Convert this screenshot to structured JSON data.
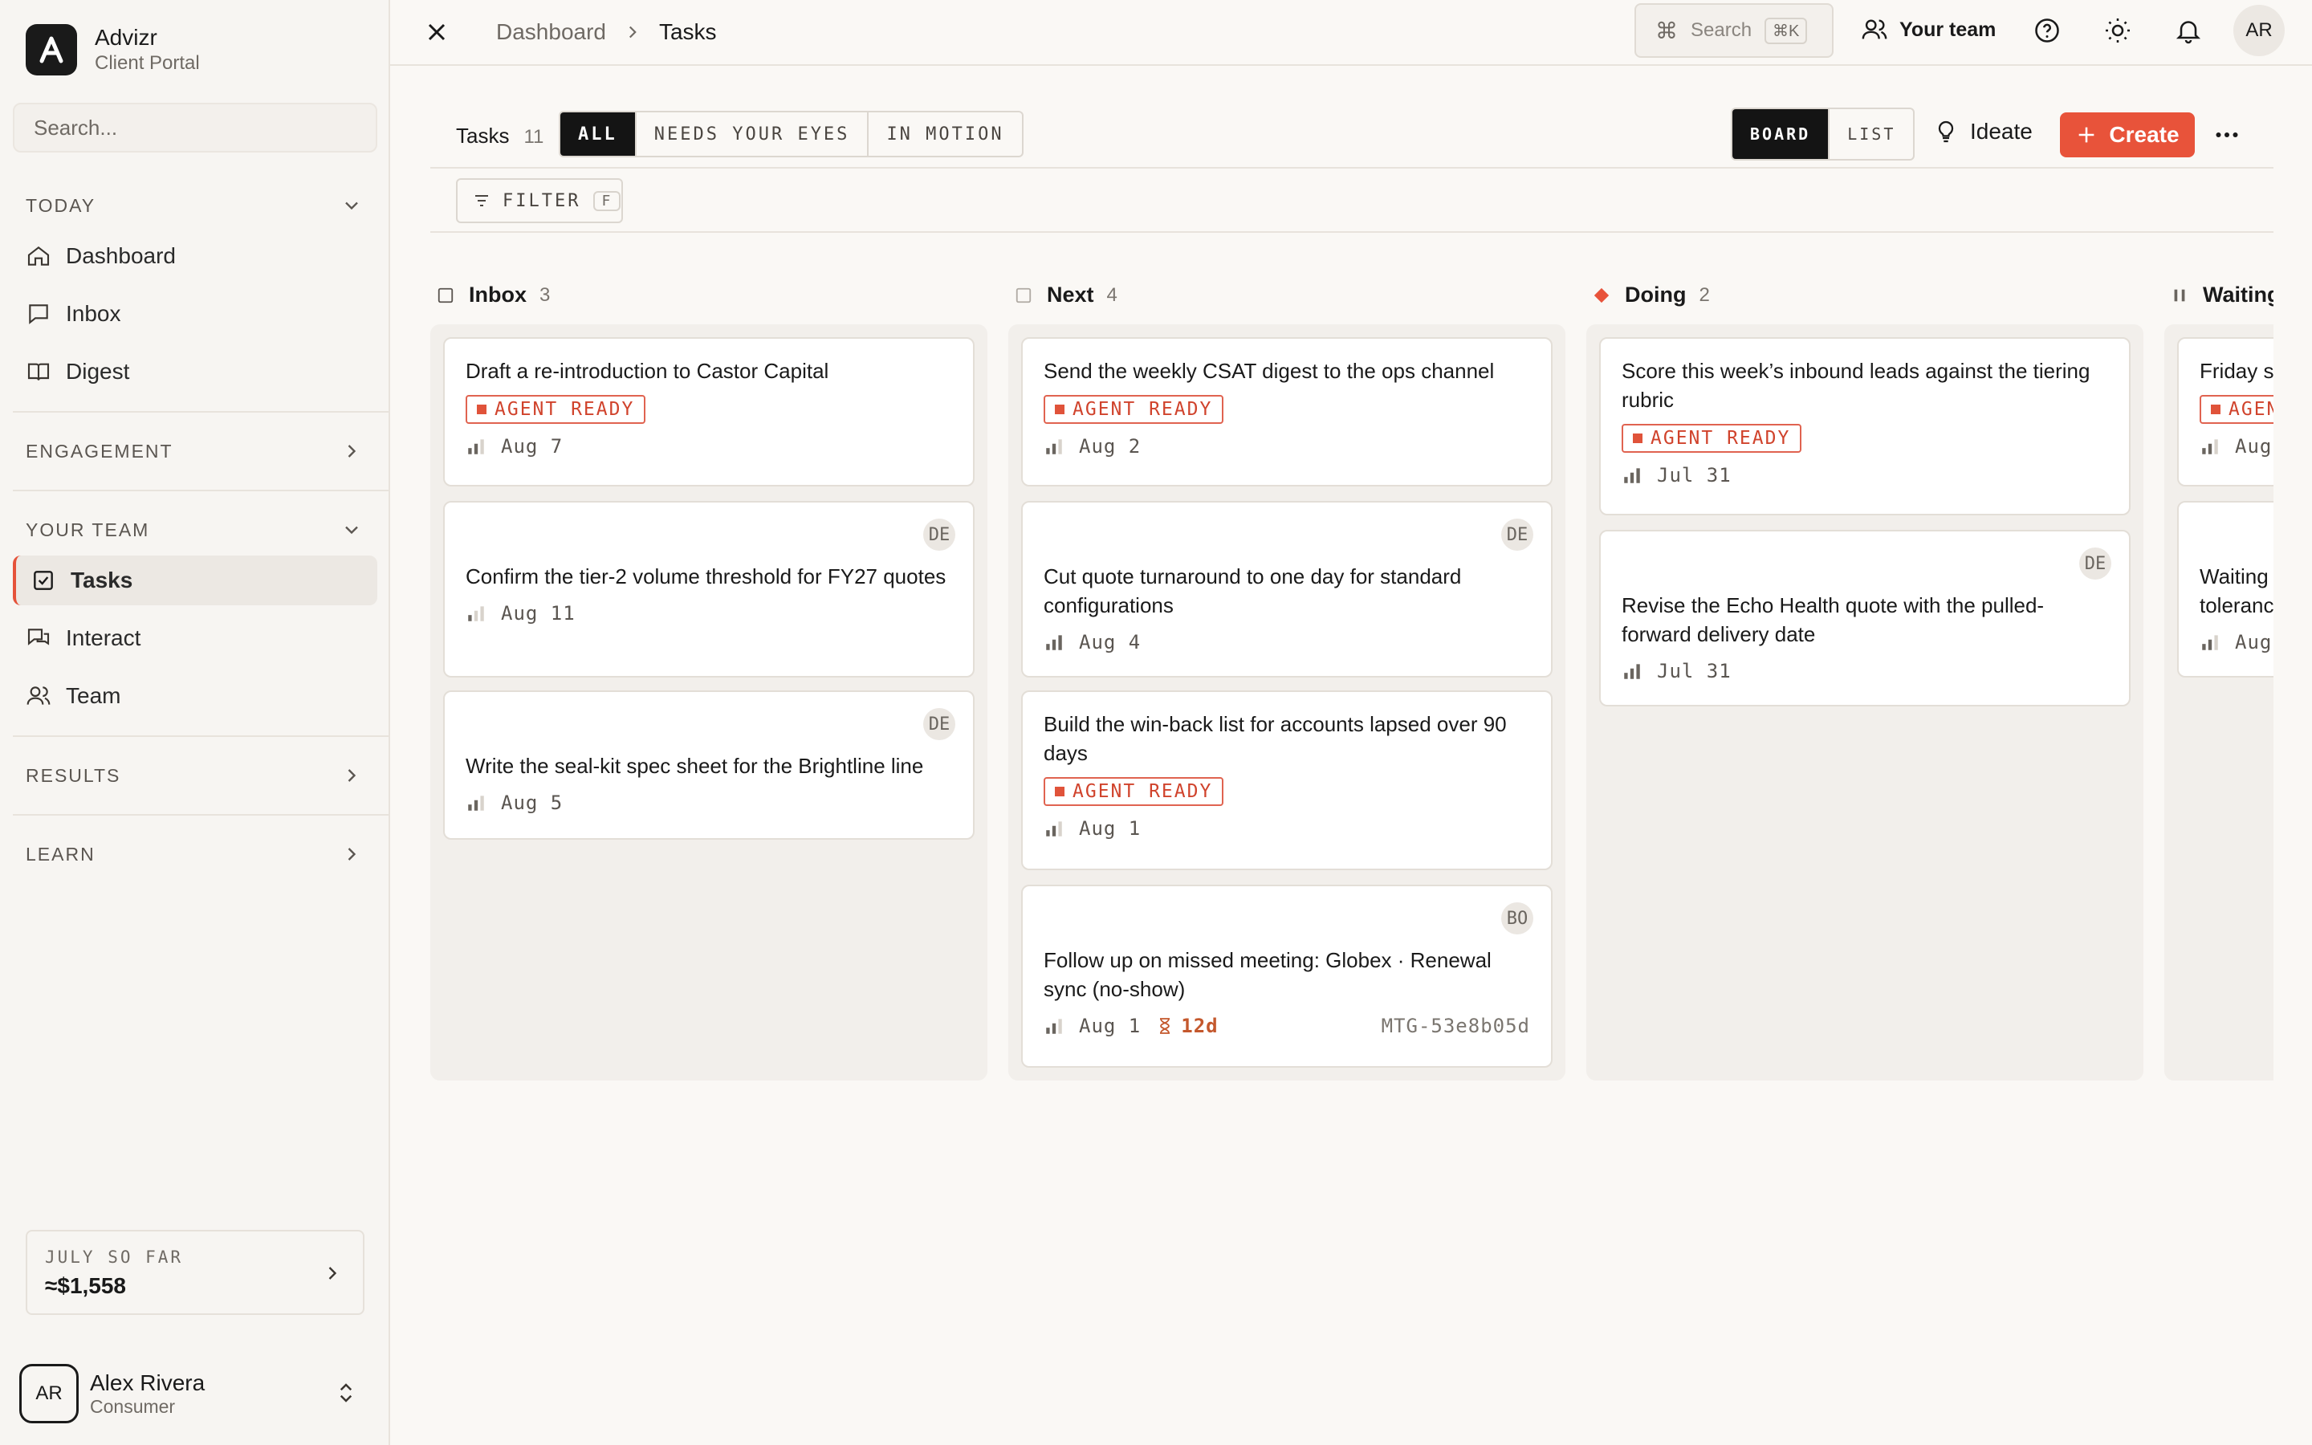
{
  "app": {
    "name": "Advizr",
    "subtitle": "Client Portal"
  },
  "sidebar": {
    "search_placeholder": "Search...",
    "sections": {
      "today": "TODAY",
      "engagement": "ENGAGEMENT",
      "your_team": "YOUR TEAM",
      "results": "RESULTS",
      "learn": "LEARN"
    },
    "today_items": [
      {
        "label": "Dashboard",
        "icon": "home-icon"
      },
      {
        "label": "Inbox",
        "icon": "chat-icon"
      },
      {
        "label": "Digest",
        "icon": "book-icon"
      }
    ],
    "team_items": [
      {
        "label": "Tasks",
        "icon": "checkbox-icon",
        "active": true
      },
      {
        "label": "Interact",
        "icon": "chat-bubbles-icon"
      },
      {
        "label": "Team",
        "icon": "users-icon"
      }
    ],
    "summary": {
      "label": "JULY SO FAR",
      "value": "≈$1,558"
    },
    "user": {
      "initials": "AR",
      "name": "Alex Rivera",
      "role": "Consumer"
    }
  },
  "topbar": {
    "breadcrumb": [
      "Dashboard",
      "Tasks"
    ],
    "search_label": "Search",
    "search_shortcut": "⌘K",
    "team_label": "Your team",
    "avatar_initials": "AR"
  },
  "toolbar": {
    "title": "Tasks",
    "count": "11",
    "filters": [
      "ALL",
      "NEEDS YOUR EYES",
      "IN MOTION"
    ],
    "active_filter": "ALL",
    "views": [
      "BOARD",
      "LIST"
    ],
    "active_view": "BOARD",
    "ideate_label": "Ideate",
    "create_label": "Create",
    "filter_label": "FILTER",
    "filter_shortcut": "F"
  },
  "board": {
    "badge_text": "AGENT READY",
    "columns": [
      {
        "name": "Inbox",
        "count": "3",
        "cards": [
          {
            "title": "Draft a re-introduction to Castor Capital",
            "date": "Aug 7",
            "badge": true
          },
          {
            "title": "Confirm the tier-2 volume threshold for FY27 quotes",
            "date": "Aug 11",
            "avatar": "DE"
          },
          {
            "title": "Write the seal-kit spec sheet for the Brightline line",
            "date": "Aug 5",
            "avatar": "DE"
          }
        ]
      },
      {
        "name": "Next",
        "count": "4",
        "cards": [
          {
            "title": "Send the weekly CSAT digest to the ops channel",
            "date": "Aug 2",
            "badge": true
          },
          {
            "title": "Cut quote turnaround to one day for standard configurations",
            "date": "Aug 4",
            "avatar": "DE"
          },
          {
            "title": "Build the win-back list for accounts lapsed over 90 days",
            "date": "Aug 1",
            "badge": true
          },
          {
            "title": "Follow up on missed meeting: Globex · Renewal sync (no-show)",
            "date": "Aug 1",
            "avatar": "BO",
            "timer": "12d",
            "code": "MTG-53e8b05d"
          }
        ]
      },
      {
        "name": "Doing",
        "count": "2",
        "cards": [
          {
            "title": "Score this week’s inbound leads against the tiering rubric",
            "date": "Jul 31",
            "badge": true
          },
          {
            "title": "Revise the Echo Health quote with the pulled-forward delivery date",
            "date": "Jul 31",
            "avatar": "DE"
          }
        ]
      },
      {
        "name": "Waiting",
        "count": "",
        "cards": [
          {
            "title": "Friday su",
            "date": "Aug",
            "badge": true,
            "badge_partial": "AGEN"
          },
          {
            "title": "Waiting tolerance",
            "date": "Aug"
          }
        ]
      }
    ]
  },
  "colors": {
    "accent": "#e8533a",
    "dark": "#141414",
    "doing": "#e8533a"
  }
}
